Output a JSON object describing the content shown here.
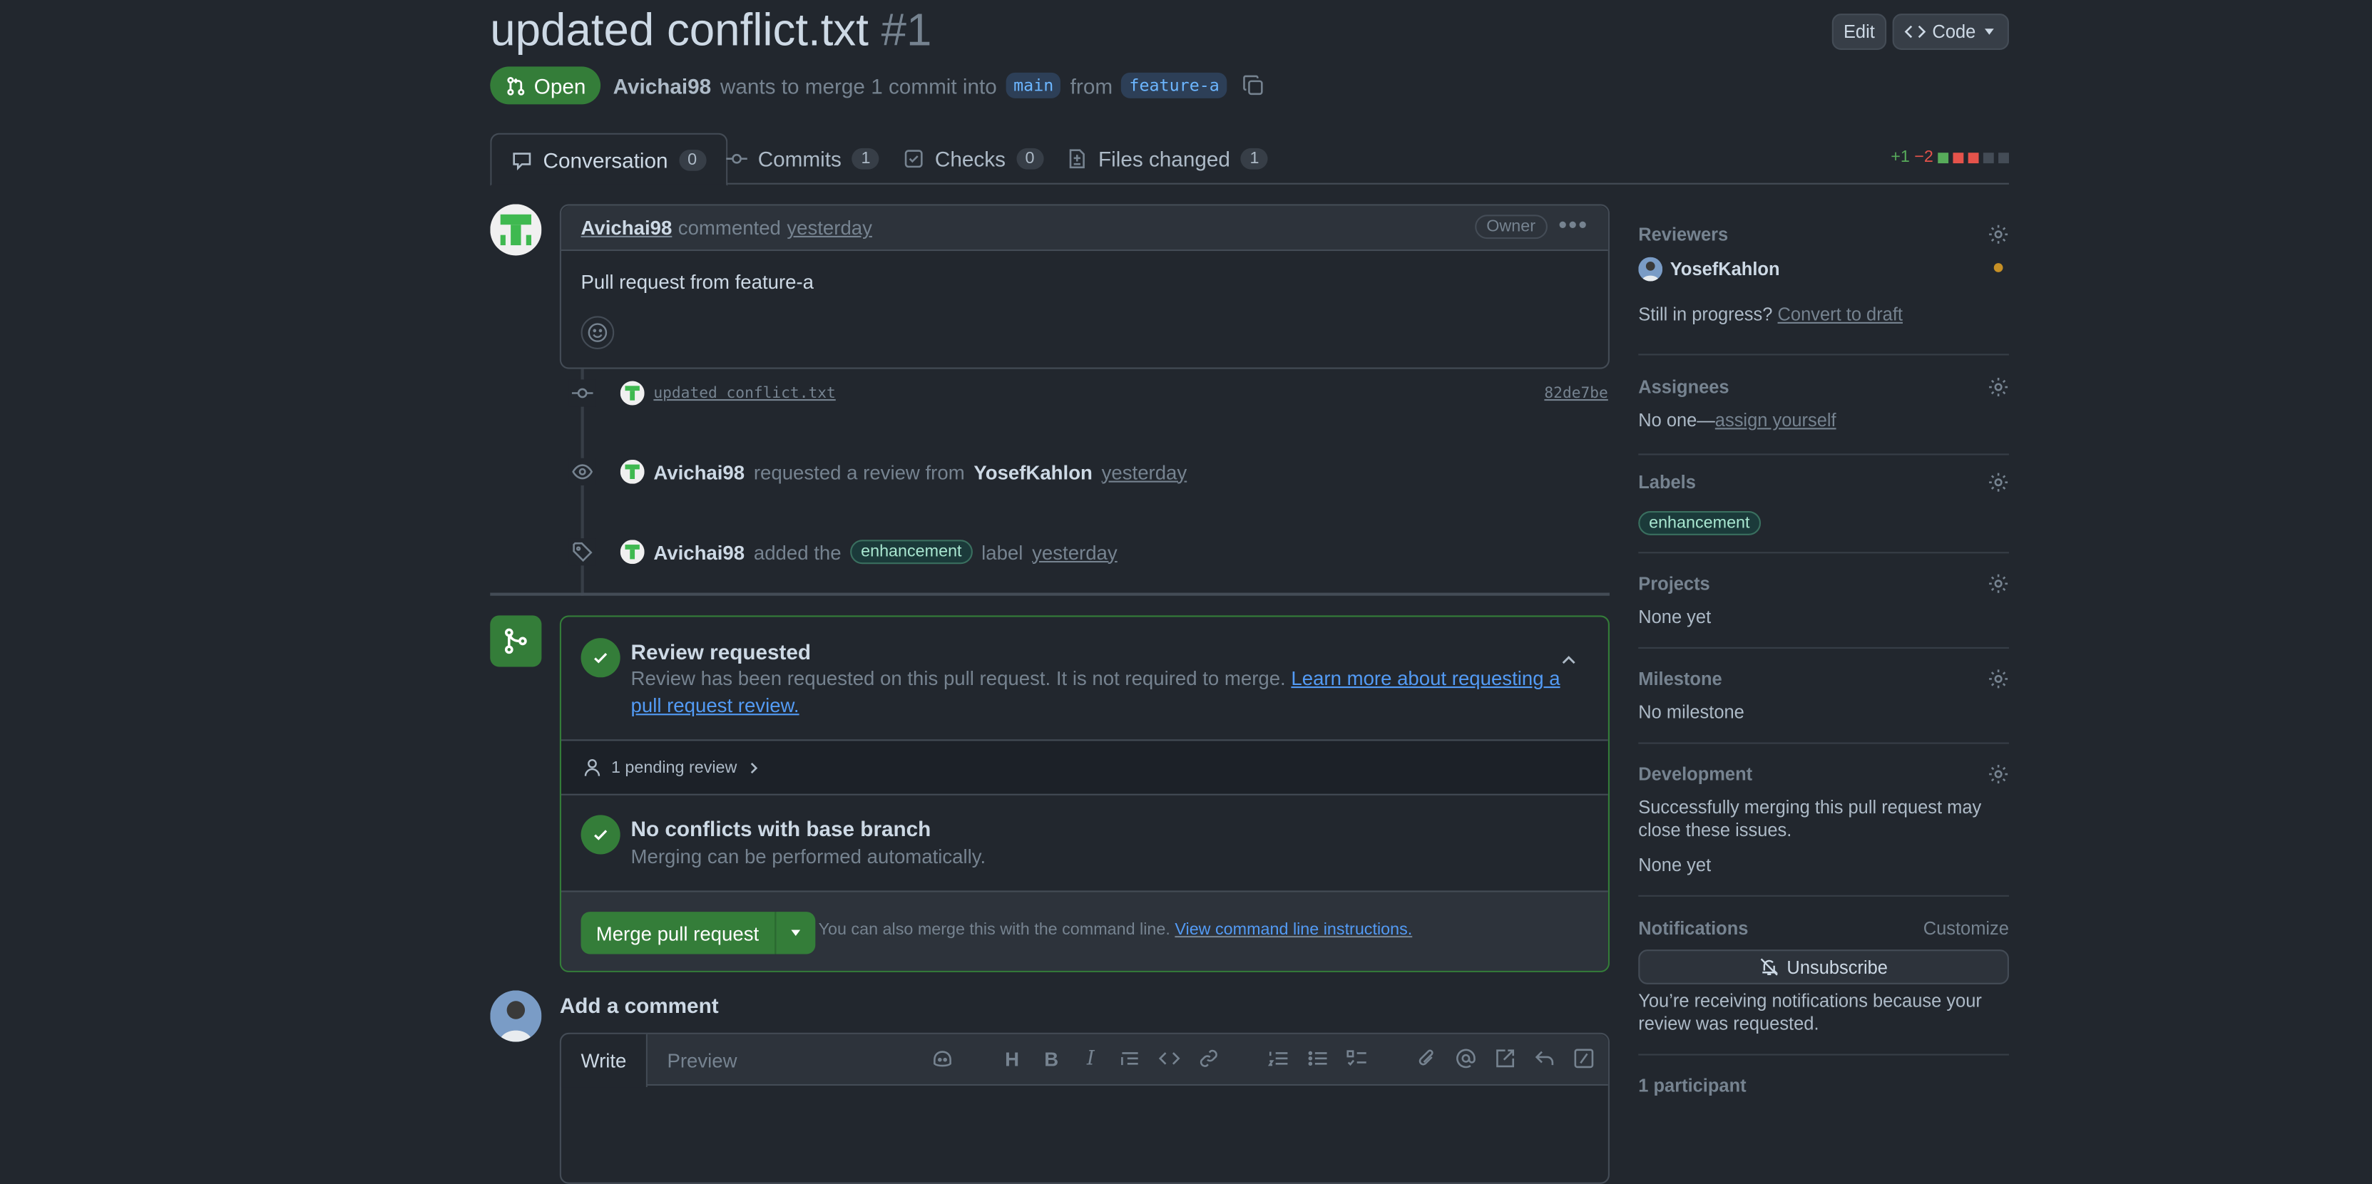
{
  "header": {
    "title": "updated conflict.txt",
    "number": "#1",
    "edit_label": "Edit",
    "code_label": "Code",
    "state": "Open",
    "author": "Avichai98",
    "merge_text": "wants to merge 1 commit into",
    "base_branch": "main",
    "from_text": "from",
    "head_branch": "feature-a"
  },
  "tabs": [
    {
      "label": "Conversation",
      "count": "0",
      "icon": "comment-icon"
    },
    {
      "label": "Commits",
      "count": "1",
      "icon": "commit-icon"
    },
    {
      "label": "Checks",
      "count": "0",
      "icon": "checks-icon"
    },
    {
      "label": "Files changed",
      "count": "1",
      "icon": "file-diff-icon"
    }
  ],
  "diffstat": {
    "additions": "+1",
    "deletions": "−2"
  },
  "comment": {
    "author": "Avichai98",
    "action": "commented",
    "time": "yesterday",
    "role": "Owner",
    "body": "Pull request from feature-a"
  },
  "timeline": {
    "commit_message": "updated conflict.txt",
    "commit_sha": "82de7be",
    "review_actor": "Avichai98",
    "review_text": "requested a review from",
    "review_target": "YosefKahlon",
    "review_time": "yesterday",
    "label_actor": "Avichai98",
    "label_text": "added the",
    "label_name": "enhancement",
    "label_suffix": "label",
    "label_time": "yesterday"
  },
  "mergebox": {
    "review_title": "Review requested",
    "review_desc": "Review has been requested on this pull request. It is not required to merge.",
    "review_link": "Learn more about requesting a pull request review.",
    "pending": "1 pending review",
    "conflict_title": "No conflicts with base branch",
    "conflict_desc": "Merging can be performed automatically.",
    "merge_button": "Merge pull request",
    "cli_note": "You can also merge this with the command line.",
    "cli_link": "View command line instructions."
  },
  "add_comment": {
    "title": "Add a comment",
    "write_tab": "Write",
    "preview_tab": "Preview"
  },
  "sidebar": {
    "reviewers_title": "Reviewers",
    "reviewer": "YosefKahlon",
    "draft_prefix": "Still in progress?",
    "draft_link": "Convert to draft",
    "assignees_title": "Assignees",
    "assignees_none": "No one—",
    "assign_link": "assign yourself",
    "labels_title": "Labels",
    "label": "enhancement",
    "projects_title": "Projects",
    "projects_value": "None yet",
    "milestone_title": "Milestone",
    "milestone_value": "No milestone",
    "development_title": "Development",
    "development_desc": "Successfully merging this pull request may close these issues.",
    "development_value": "None yet",
    "notifications_title": "Notifications",
    "customize": "Customize",
    "unsubscribe": "Unsubscribe",
    "notif_reason": "You’re receiving notifications because your review was requested.",
    "participants": "1 participant"
  },
  "colors": {
    "background": "#22272e",
    "open_green": "#347d39",
    "link_blue": "#539bf5",
    "pending_orange": "#c69026"
  }
}
